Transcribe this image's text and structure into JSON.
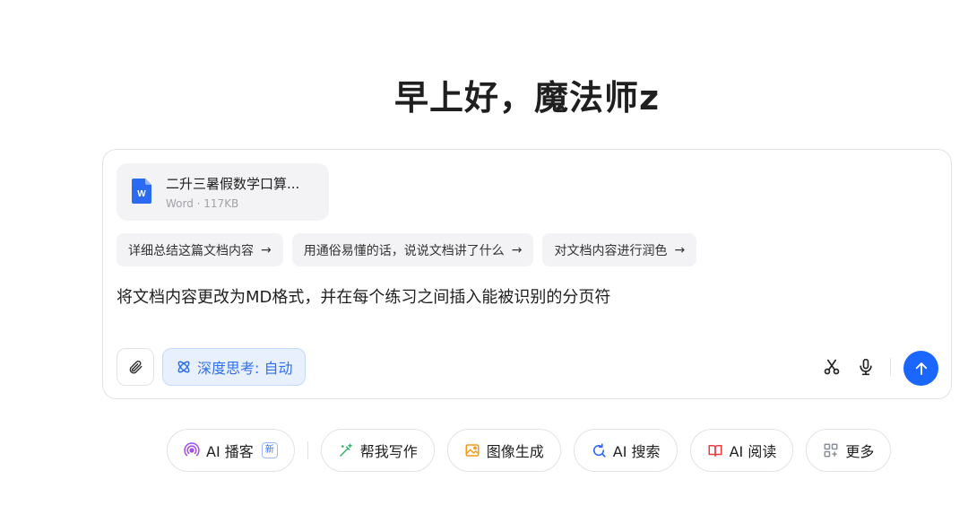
{
  "greeting": "早上好，魔法师z",
  "file": {
    "name": "二升三暑假数学口算...",
    "meta": "Word · 117KB",
    "icon": "word-doc-icon",
    "icon_letter": "W",
    "icon_color": "#2b6bf3"
  },
  "suggestions": [
    {
      "label": "详细总结这篇文档内容",
      "arrow": "→"
    },
    {
      "label": "用通俗易懂的话，说说文档讲了什么",
      "arrow": "→"
    },
    {
      "label": "对文档内容进行润色",
      "arrow": "→"
    }
  ],
  "prompt": "将文档内容更改为MD格式，并在每个练习之间插入能被识别的分页符",
  "toolbar": {
    "attach_icon": "paperclip-icon",
    "think_label": "深度思考: 自动",
    "think_icon": "atom-icon",
    "scissors_icon": "scissors-icon",
    "mic_icon": "microphone-icon",
    "send_icon": "arrow-up-icon",
    "send_color": "#1a66ff"
  },
  "features": [
    {
      "label": "AI 播客",
      "icon": "podcast-icon",
      "badge": "新",
      "color": "#a34ee8"
    },
    {
      "label": "帮我写作",
      "icon": "pen-sparkle-icon",
      "color": "#2fb46a"
    },
    {
      "label": "图像生成",
      "icon": "image-icon",
      "color": "#f29a1b"
    },
    {
      "label": "AI 搜索",
      "icon": "search-refresh-icon",
      "color": "#2f6ef2"
    },
    {
      "label": "AI 阅读",
      "icon": "book-icon",
      "color": "#ee3b3b"
    },
    {
      "label": "更多",
      "icon": "grid-icon",
      "color": "#8a8f99"
    }
  ]
}
